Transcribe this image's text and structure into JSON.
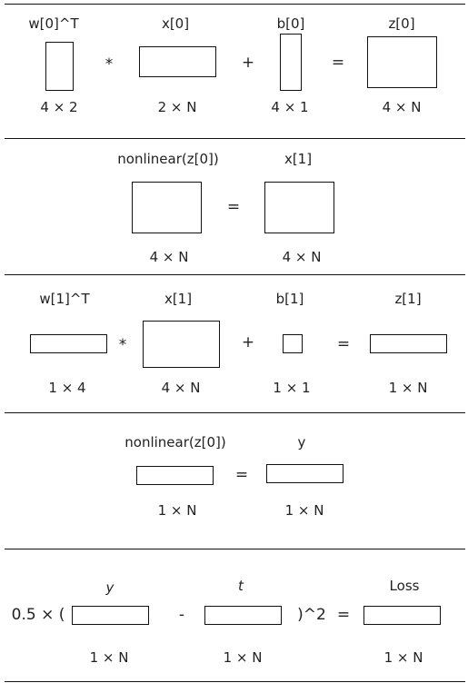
{
  "sections": [
    {
      "id": "layer0-linear",
      "labels": [
        "w[0]^T",
        "x[0]",
        "b[0]",
        "z[0]"
      ],
      "dims": [
        "4 × 2",
        "2 × N",
        "4 × 1",
        "4 × N"
      ],
      "ops": [
        "*",
        "+",
        "="
      ]
    },
    {
      "id": "layer0-activation",
      "labels": [
        "nonlinear(z[0])",
        "x[1]"
      ],
      "dims": [
        "4 × N",
        "4 × N"
      ],
      "ops": [
        "="
      ]
    },
    {
      "id": "layer1-linear",
      "labels": [
        "w[1]^T",
        "x[1]",
        "b[1]",
        "z[1]"
      ],
      "dims": [
        "1 × 4",
        "4 × N",
        "1 × 1",
        "1 × N"
      ],
      "ops": [
        "*",
        "+",
        "="
      ]
    },
    {
      "id": "layer1-activation",
      "labels": [
        "nonlinear(z[0])",
        "y"
      ],
      "dims": [
        "1 × N",
        "1 × N"
      ],
      "ops": [
        "="
      ]
    },
    {
      "id": "loss",
      "labels": [
        "y",
        "t",
        "Loss"
      ],
      "dims": [
        "1 × N",
        "1 × N",
        "1 × N"
      ],
      "ops": [
        "0.5 × (",
        "-",
        ")^2",
        "="
      ]
    }
  ]
}
